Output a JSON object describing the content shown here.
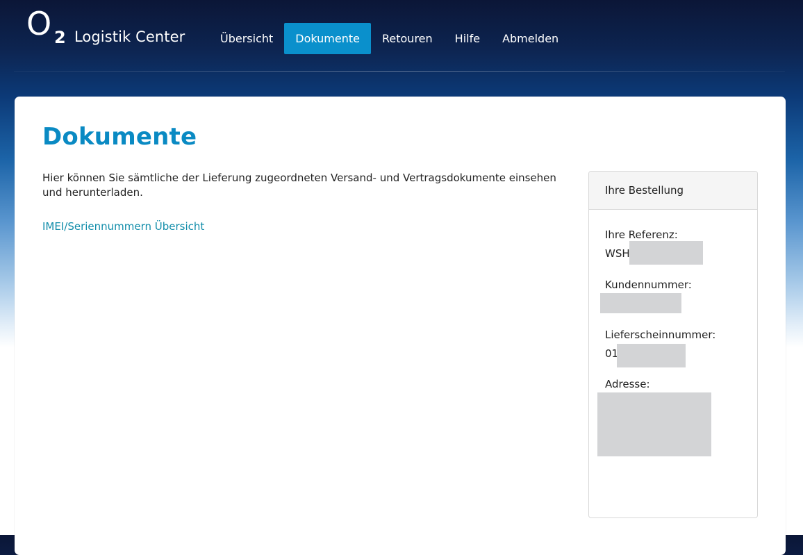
{
  "header": {
    "logo_text": "O",
    "logo_subscript": "2",
    "app_title": "Logistik Center",
    "nav": [
      {
        "label": "Übersicht",
        "active": false
      },
      {
        "label": "Dokumente",
        "active": true
      },
      {
        "label": "Retouren",
        "active": false
      },
      {
        "label": "Hilfe",
        "active": false
      },
      {
        "label": "Abmelden",
        "active": false
      }
    ]
  },
  "main": {
    "title": "Dokumente",
    "intro": "Hier können Sie sämtliche der Lieferung zugeordneten Versand- und Vertragsdokumente einsehen und herunterladen.",
    "imei_link": "IMEI/Seriennummern Übersicht"
  },
  "order": {
    "heading": "Ihre Bestellung",
    "reference_label": "Ihre Referenz:",
    "reference_value_prefix": "WSH",
    "customer_number_label": "Kundennummer:",
    "delivery_note_label": "Lieferscheinnummer:",
    "delivery_note_value_prefix": "01",
    "address_label": "Adresse:"
  },
  "colors": {
    "accent": "#0a90cc",
    "title": "#0a8ac3",
    "link": "#118daa",
    "header_dark": "#0b1637",
    "redaction": "#d3d4d6"
  }
}
